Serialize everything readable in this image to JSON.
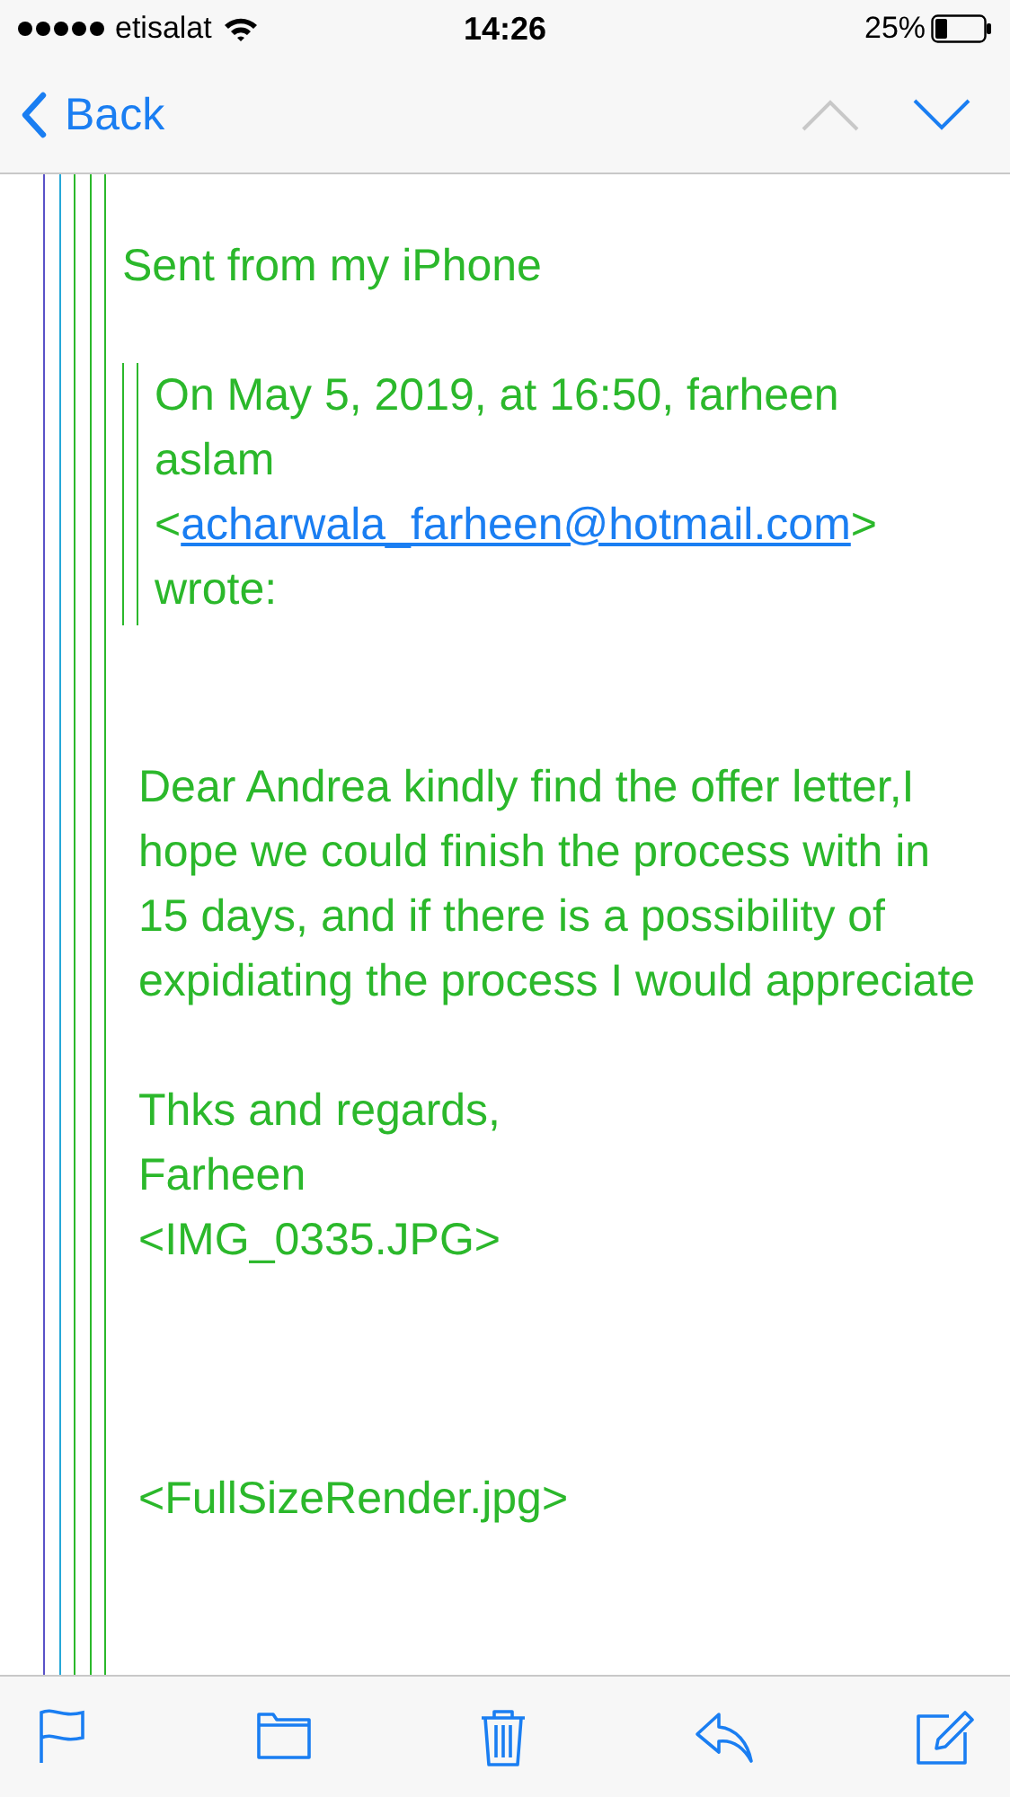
{
  "status_bar": {
    "carrier": "etisalat",
    "time": "14:26",
    "battery_percent": "25%"
  },
  "nav": {
    "back_label": "Back",
    "previous_enabled": false,
    "next_enabled": true
  },
  "message": {
    "signature": "Sent from my iPhone",
    "attribution": {
      "before": "On May 5, 2019, at 16:50, farheen aslam <",
      "link": "acharwala_farheen@hotmail.com",
      "after": "> wrote:"
    },
    "blocks": [
      {
        "kind": "paragraph",
        "text": "Dear Andrea kindly find the offer letter,I hope we could finish the process with in 15 days, and if there is a possibility of expidiating the process I would appreciate"
      },
      {
        "kind": "lines",
        "lines": [
          "Thks and regards,",
          "Farheen",
          "<IMG_0335.JPG>"
        ]
      },
      {
        "kind": "lines",
        "lines": [
          "<FullSizeRender.jpg>"
        ]
      }
    ]
  },
  "toolbar": [
    {
      "kind": "flag"
    },
    {
      "kind": "folder"
    },
    {
      "kind": "trash"
    },
    {
      "kind": "reply"
    },
    {
      "kind": "compose"
    }
  ]
}
